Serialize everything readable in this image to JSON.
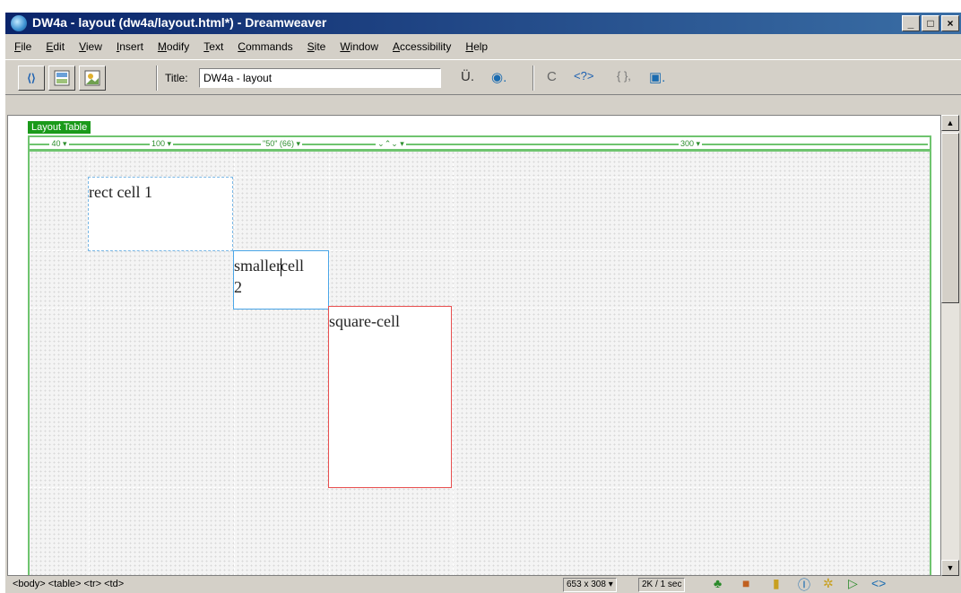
{
  "window": {
    "title": "DW4a - layout (dw4a/layout.html*) - Dreamweaver",
    "controls": [
      "_",
      "□",
      "×"
    ]
  },
  "menu": [
    "File",
    "Edit",
    "View",
    "Insert",
    "Modify",
    "Text",
    "Commands",
    "Site",
    "Window",
    "Accessibility",
    "Help"
  ],
  "toolbar": {
    "title_label": "Title:",
    "title_value": "DW4a - layout",
    "code_icon": "⟨⟩",
    "icons": [
      "Ü.",
      "◉.",
      "C",
      "<?>",
      "{ },",
      "▣."
    ]
  },
  "layout": {
    "tab_label": "Layout Table",
    "columns": [
      "40 ▾",
      "100 ▾",
      "\"50\" (66) ▾",
      "⌄⌃⌄ ▾",
      "300 ▾"
    ]
  },
  "cells": {
    "cell1": "rect cell 1",
    "cell2_a": "smaller",
    "cell2_b": "cell",
    "cell2_c": "2",
    "cell3": "square-cell"
  },
  "status": {
    "tag_selector": "<body> <table> <tr> <td>",
    "window_size": "653 x 308 ▾",
    "download": "2K / 1 sec"
  }
}
